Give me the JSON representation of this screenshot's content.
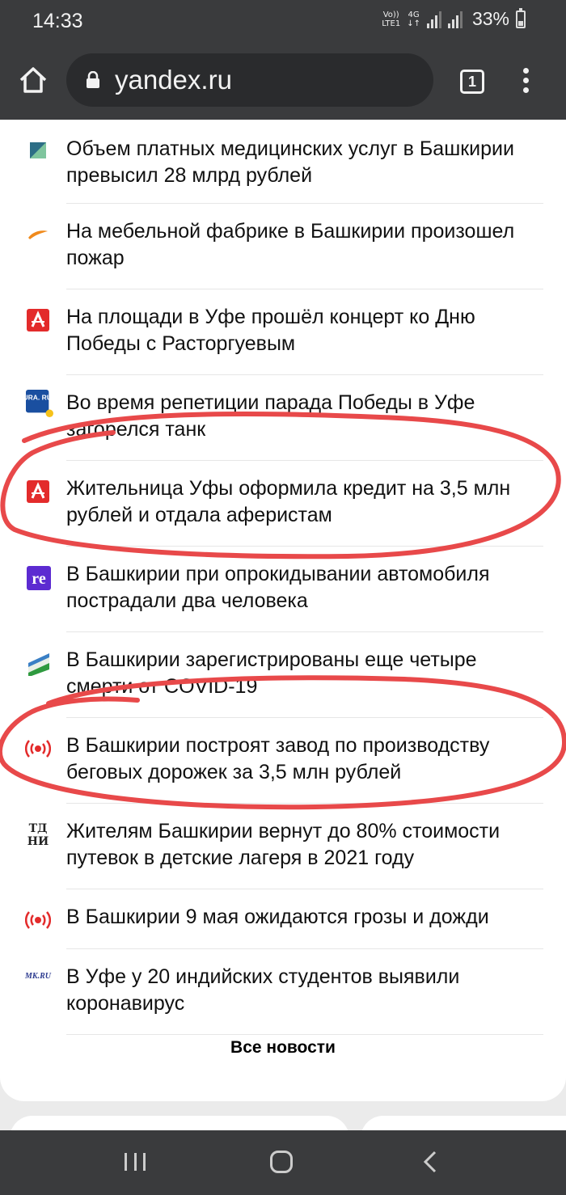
{
  "status_bar": {
    "time": "14:33",
    "network_top": "Vo))",
    "network_bottom": "LTE1",
    "net_type": "4G",
    "battery": "33%"
  },
  "browser": {
    "url": "yandex.ru",
    "tab_count": "1",
    "icons": [
      "home-icon",
      "lock-icon",
      "tabs-icon",
      "more-vert-icon"
    ]
  },
  "news": {
    "items": [
      {
        "title": "Объем платных медицинских услуг в Башкирии превысил 28 млрд рублей",
        "source_icon": "green-triangle-logo-icon"
      },
      {
        "title": "На мебельной фабрике в Башкирии произошел пожар",
        "source_icon": "orange-swoosh-logo-icon"
      },
      {
        "title": "На площади в Уфе прошёл концерт ко Дню Победы с Расторгуевым",
        "source_icon": "red-square-logo-icon"
      },
      {
        "title": "Во время репетиции парада Победы в Уфе загорелся танк",
        "source_icon": "ura-ru-logo-icon",
        "source_label": "URA. RU"
      },
      {
        "title": "Жительница Уфы оформила кредит на 3,5 млн рублей и отдала аферистам",
        "source_icon": "red-square-logo-icon"
      },
      {
        "title": "В Башкирии при опрокидывании автомобиля пострадали два человека",
        "source_icon": "re-logo-icon",
        "source_label": "re"
      },
      {
        "title": "В Башкирии зарегистрированы еще четыре смерти от COVID-19",
        "source_icon": "bashkir-flag-logo-icon"
      },
      {
        "title": "В Башкирии построят завод по производству беговых дорожек за 3,5 млн рублей",
        "source_icon": "broadcast-logo-icon"
      },
      {
        "title": "Жителям Башкирии вернут до 80% стоимости путевок в детские лагеря в 2021 году",
        "source_icon": "gothic-letters-logo-icon",
        "source_label": "ТД НИ"
      },
      {
        "title": "В Башкирии 9 мая ожидаются грозы и дожди",
        "source_icon": "broadcast-logo-icon"
      },
      {
        "title": "В Уфе у 20 индийских студентов выявили коронавирус",
        "source_icon": "mk-ru-logo-icon",
        "source_label": "MK.RU"
      }
    ],
    "all_news_label": "Все новости"
  },
  "colors": {
    "chrome_bg": "#3a3b3d",
    "annotation_red": "#e8494a",
    "ura_blue": "#1a4fa0",
    "re_purple": "#5c2bd1",
    "red_logo": "#e32b2b"
  }
}
